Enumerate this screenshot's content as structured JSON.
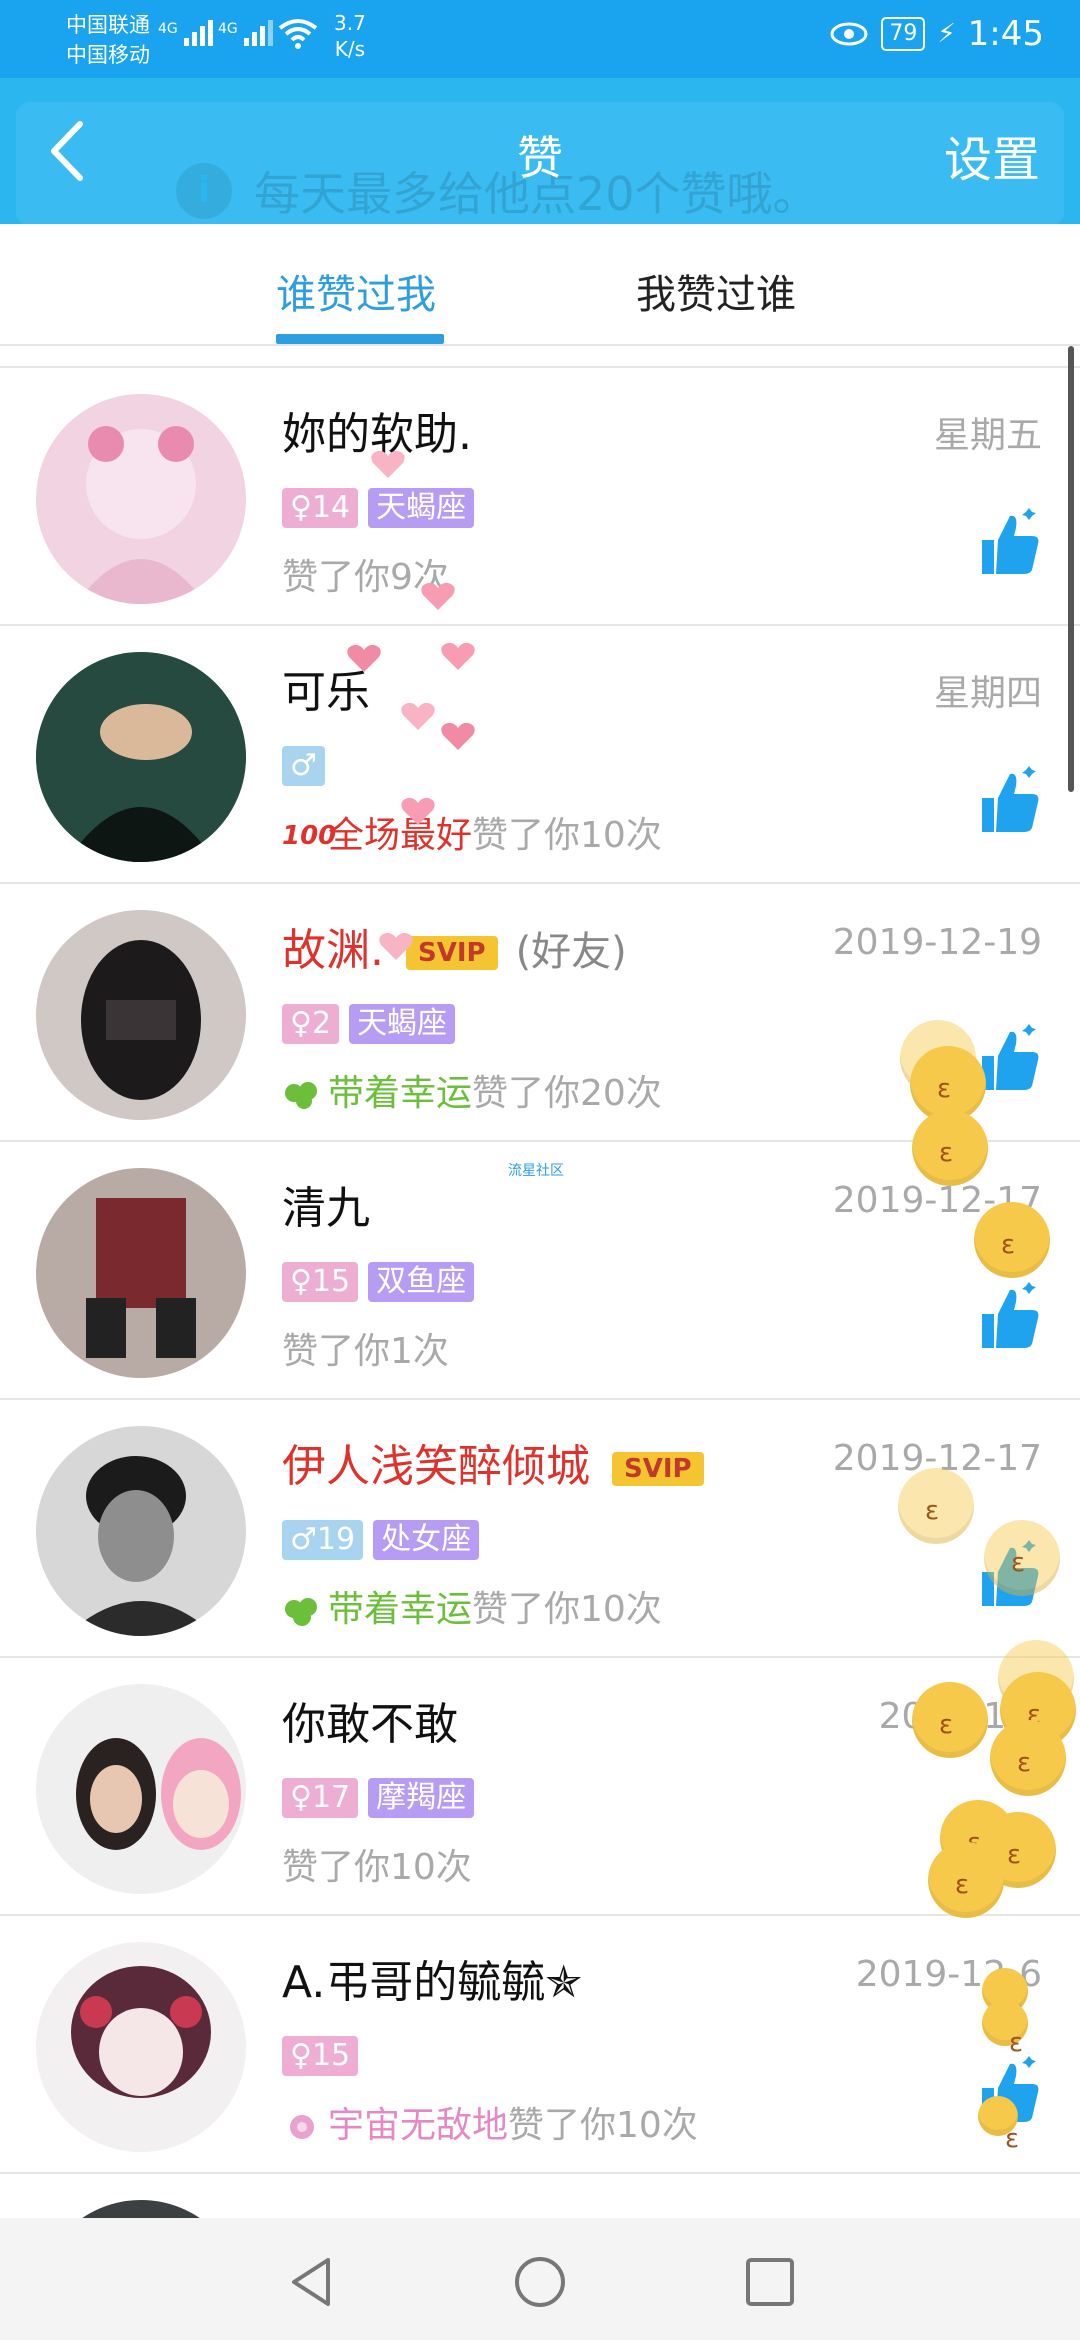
{
  "status_bar": {
    "carrier1": "中国联通",
    "carrier2": "中国移动",
    "network1": "4G",
    "network2": "4G",
    "speed_value": "3.7",
    "speed_unit": "K/s",
    "battery": "79",
    "time": "1:45"
  },
  "header": {
    "title": "赞",
    "settings_label": "设置",
    "notice": "每天最多给他点20个赞哦。"
  },
  "tabs": [
    {
      "label": "谁赞过我",
      "active": true
    },
    {
      "label": "我赞过谁",
      "active": false
    }
  ],
  "watermark": "流星社区",
  "rows": [
    {
      "name": "妳的软助.",
      "date": "星期五",
      "gender_tag": "♀14",
      "zodiac": "天蝎座",
      "liked_prefix": "",
      "liked_text": "赞了你9次"
    },
    {
      "name": "可乐",
      "date": "星期四",
      "gender_tag": "♂",
      "zodiac": "",
      "liked_prefix": "全场最好",
      "liked_text": "赞了你10次"
    },
    {
      "name": "故渊.",
      "date": "2019-12-19",
      "svip": "SVIP",
      "friend": "(好友)",
      "gender_tag": "♀2",
      "zodiac": "天蝎座",
      "liked_prefix": "带着幸运",
      "liked_text": "赞了你20次"
    },
    {
      "name": "清九",
      "date": "2019-12-17",
      "gender_tag": "♀15",
      "zodiac": "双鱼座",
      "liked_prefix": "",
      "liked_text": "赞了你1次"
    },
    {
      "name": "伊人浅笑醉倾城",
      "date": "2019-12-17",
      "svip": "SVIP",
      "gender_tag": "♂19",
      "zodiac": "处女座",
      "liked_prefix": "带着幸运",
      "liked_text": "赞了你10次"
    },
    {
      "name": "你敢不敢",
      "date": "2019-12-",
      "gender_tag": "♀17",
      "zodiac": "摩羯座",
      "liked_prefix": "",
      "liked_text": "赞了你10次"
    },
    {
      "name": "A.弔哥的毓毓✯",
      "date": "2019-12-6",
      "gender_tag": "♀15",
      "zodiac": "",
      "liked_prefix": "宇宙无敌地",
      "liked_text": "赞了你10次"
    }
  ],
  "colors": {
    "status_bar": "#1aa3ee",
    "header": "#2cb6f0",
    "tab_active": "#2f9ee0",
    "vip_name": "#e0322c",
    "female_tag": "#eeaed4",
    "male_tag": "#a8d4ef",
    "zodiac_tag": "#b79cf4",
    "thumb": "#1fa3ee"
  },
  "icons": {
    "back": "chevron-left-icon",
    "thumb": "thumbs-up-icon",
    "nav_back": "triangle-back-icon",
    "nav_home": "circle-home-icon",
    "nav_recent": "square-recent-icon"
  }
}
